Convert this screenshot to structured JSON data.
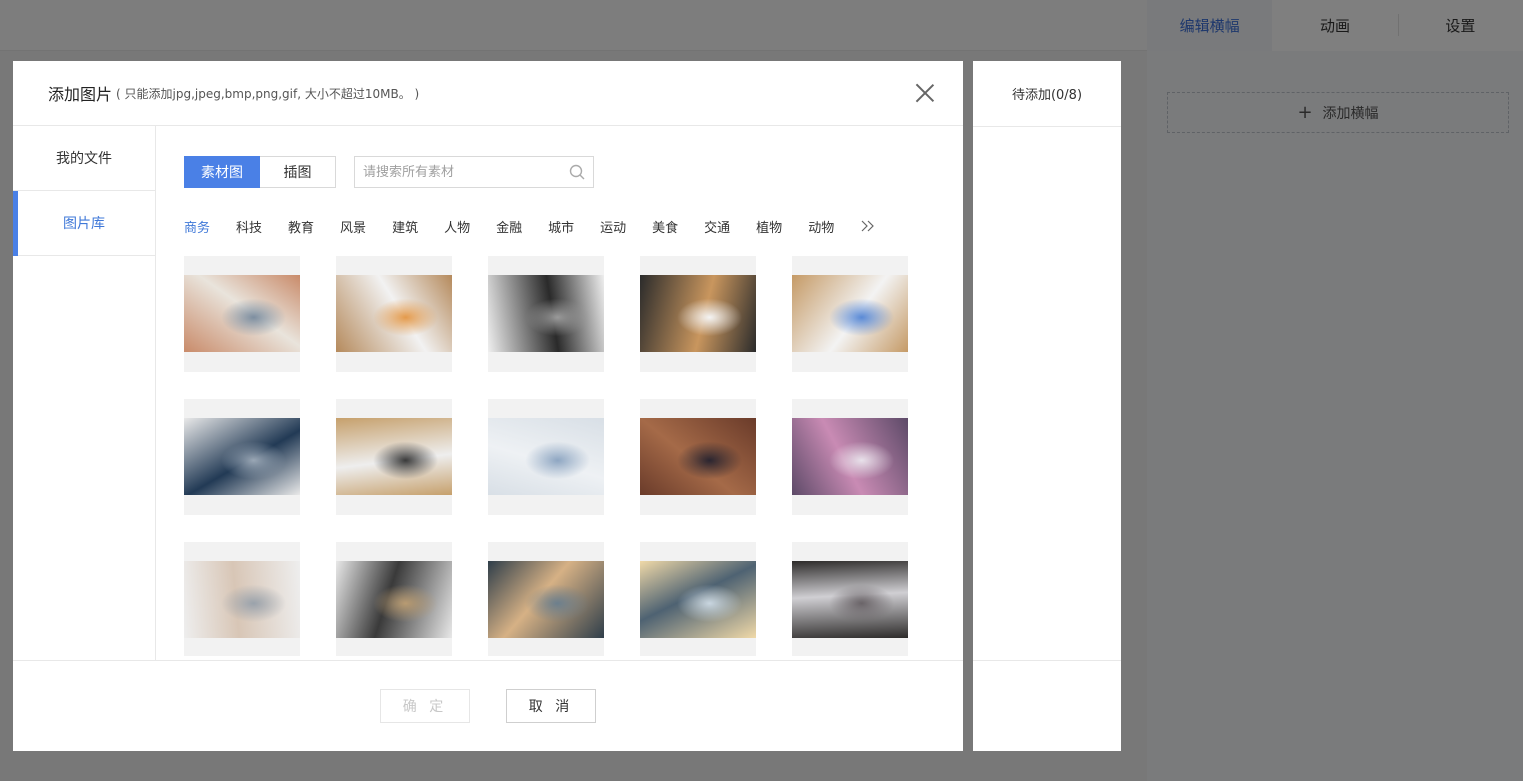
{
  "background": {
    "tabs": [
      {
        "label": "编辑横幅"
      },
      {
        "label": "动画"
      },
      {
        "label": "设置"
      }
    ],
    "add_banner_label": "添加横幅"
  },
  "modal": {
    "title": "添加图片",
    "hint": "( 只能添加jpg,jpeg,bmp,png,gif, 大小不超过10MB。 )",
    "side_nav": [
      {
        "label": "我的文件"
      },
      {
        "label": "图片库"
      }
    ],
    "toggle": [
      {
        "label": "素材图"
      },
      {
        "label": "插图"
      }
    ],
    "search": {
      "placeholder": "请搜索所有素材"
    },
    "categories": [
      {
        "label": "商务"
      },
      {
        "label": "科技"
      },
      {
        "label": "教育"
      },
      {
        "label": "风景"
      },
      {
        "label": "建筑"
      },
      {
        "label": "人物"
      },
      {
        "label": "金融"
      },
      {
        "label": "城市"
      },
      {
        "label": "运动"
      },
      {
        "label": "美食"
      },
      {
        "label": "交通"
      },
      {
        "label": "植物"
      },
      {
        "label": "动物"
      }
    ],
    "images": [
      {
        "icon": "laptop-desk-photo",
        "palette": [
          "#c98b6a",
          "#e9e4dc",
          "#7d8ea0"
        ]
      },
      {
        "icon": "charts-desk-photo",
        "palette": [
          "#b58a5c",
          "#f2f2f2",
          "#e49a4b"
        ]
      },
      {
        "icon": "tablet-desk-photo",
        "palette": [
          "#efefef",
          "#2a2a2a",
          "#9a9a9a"
        ]
      },
      {
        "icon": "imac-desk-photo",
        "palette": [
          "#2b2b2b",
          "#c9965e",
          "#f4f4f4"
        ]
      },
      {
        "icon": "chart-paper-photo",
        "palette": [
          "#c59a66",
          "#f3f3f3",
          "#5a8ad6"
        ]
      },
      {
        "icon": "laptop-office-photo",
        "palette": [
          "#e9e9e9",
          "#223a55",
          "#9aa7b5"
        ]
      },
      {
        "icon": "laptop-graphs-photo",
        "palette": [
          "#c6a06c",
          "#eeeeee",
          "#3a3a3a"
        ]
      },
      {
        "icon": "meeting-laptop-photo",
        "palette": [
          "#d8dfe6",
          "#eef1f4",
          "#8ea6c2"
        ]
      },
      {
        "icon": "woman-laptop-photo",
        "palette": [
          "#6a3b2a",
          "#a56a48",
          "#2a2530"
        ]
      },
      {
        "icon": "people-laptop-photo",
        "palette": [
          "#5d4a68",
          "#c98bb4",
          "#e8e1ea"
        ]
      },
      {
        "icon": "signing-paper-photo",
        "palette": [
          "#eeeeee",
          "#d8c6b6",
          "#9aa2ab"
        ]
      },
      {
        "icon": "chess-desk-photo",
        "palette": [
          "#e8e8e8",
          "#3a3a3a",
          "#b89b72"
        ]
      },
      {
        "icon": "handshake-photo",
        "palette": [
          "#2f3e4a",
          "#d6b185",
          "#6c7f8d"
        ]
      },
      {
        "icon": "meeting-sunlight-photo",
        "palette": [
          "#f0d9a8",
          "#4e6272",
          "#c9d6e0"
        ]
      },
      {
        "icon": "business-meeting-photo",
        "palette": [
          "#2d2b2a",
          "#d0cfd3",
          "#6a6468"
        ]
      }
    ],
    "footer": {
      "confirm_label": "确 定",
      "cancel_label": "取 消"
    }
  },
  "queue_panel": {
    "title": "待添加(0/8)"
  },
  "colors": {
    "accent": "#4a80e6",
    "overlay": "rgba(0,0,0,0.5)"
  }
}
